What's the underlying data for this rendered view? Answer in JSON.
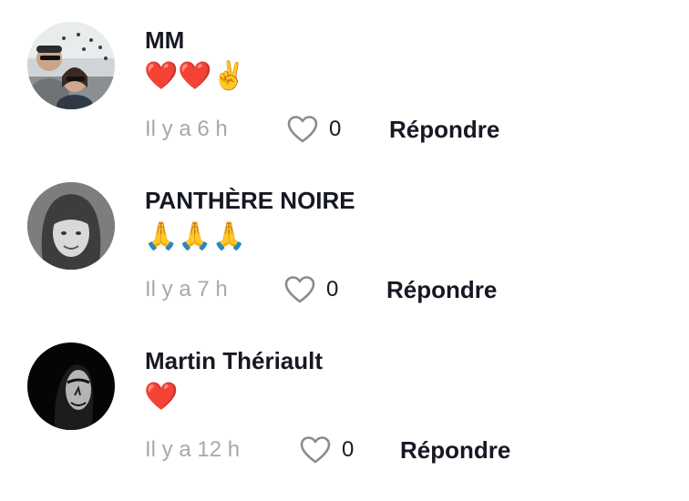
{
  "comments": [
    {
      "username": "MM",
      "text": "❤️❤️✌️",
      "time": "Il y a 6 h",
      "likes": "0",
      "reply_label": "Répondre"
    },
    {
      "username": "PANTHÈRE NOIRE",
      "text": "🙏🙏🙏",
      "time": "Il y a 7 h",
      "likes": "0",
      "reply_label": "Répondre"
    },
    {
      "username": "Martin Thériault",
      "text": "❤️",
      "time": "Il y a 12 h",
      "likes": "0",
      "reply_label": "Répondre"
    }
  ],
  "icons": {
    "like": "heart-outline-icon"
  },
  "colors": {
    "username": "#161823",
    "timestamp": "#a7a8ae",
    "icon_stroke": "#8a8b91"
  }
}
